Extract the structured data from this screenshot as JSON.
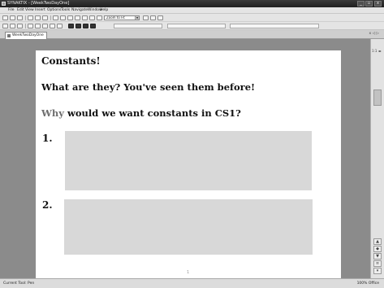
{
  "window": {
    "title": "SYNAKTIX - [WeekTwoDayOne]",
    "controls": [
      "_",
      "▫",
      "x"
    ]
  },
  "menubar": {
    "items": [
      "File",
      "Edit",
      "View",
      "Insert",
      "Options",
      "Tools",
      "Navigate",
      "Window",
      "Help"
    ]
  },
  "toolbar": {
    "zoom_value": "Zoom to Fit"
  },
  "tab": {
    "label": "WeekTwoDayOne",
    "right_controls": "x  ◁ ▷"
  },
  "document": {
    "heading": "Constants!",
    "question1": "What are they?  You've seen them before!",
    "question2_lead": "Why",
    "question2_rest": " would we want constants in CS1?",
    "item1_number": "1.",
    "item2_number": "2.",
    "page_number": "1",
    "box_color": "#d8d8d8"
  },
  "scrollbar": {
    "top_control": "1:1  ◂▸",
    "buttons": [
      "▲",
      "◆",
      "▼",
      "≡",
      "▾"
    ]
  },
  "status": {
    "left": "Current Tool: Pen",
    "right": "100%  Office"
  }
}
